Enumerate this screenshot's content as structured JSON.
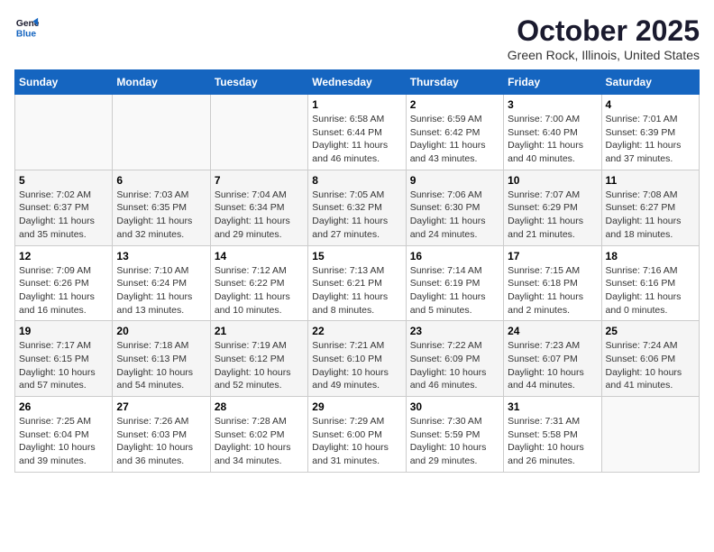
{
  "logo": {
    "line1": "General",
    "line2": "Blue"
  },
  "title": "October 2025",
  "subtitle": "Green Rock, Illinois, United States",
  "weekdays": [
    "Sunday",
    "Monday",
    "Tuesday",
    "Wednesday",
    "Thursday",
    "Friday",
    "Saturday"
  ],
  "weeks": [
    [
      {
        "day": "",
        "content": ""
      },
      {
        "day": "",
        "content": ""
      },
      {
        "day": "",
        "content": ""
      },
      {
        "day": "1",
        "content": "Sunrise: 6:58 AM\nSunset: 6:44 PM\nDaylight: 11 hours and 46 minutes."
      },
      {
        "day": "2",
        "content": "Sunrise: 6:59 AM\nSunset: 6:42 PM\nDaylight: 11 hours and 43 minutes."
      },
      {
        "day": "3",
        "content": "Sunrise: 7:00 AM\nSunset: 6:40 PM\nDaylight: 11 hours and 40 minutes."
      },
      {
        "day": "4",
        "content": "Sunrise: 7:01 AM\nSunset: 6:39 PM\nDaylight: 11 hours and 37 minutes."
      }
    ],
    [
      {
        "day": "5",
        "content": "Sunrise: 7:02 AM\nSunset: 6:37 PM\nDaylight: 11 hours and 35 minutes."
      },
      {
        "day": "6",
        "content": "Sunrise: 7:03 AM\nSunset: 6:35 PM\nDaylight: 11 hours and 32 minutes."
      },
      {
        "day": "7",
        "content": "Sunrise: 7:04 AM\nSunset: 6:34 PM\nDaylight: 11 hours and 29 minutes."
      },
      {
        "day": "8",
        "content": "Sunrise: 7:05 AM\nSunset: 6:32 PM\nDaylight: 11 hours and 27 minutes."
      },
      {
        "day": "9",
        "content": "Sunrise: 7:06 AM\nSunset: 6:30 PM\nDaylight: 11 hours and 24 minutes."
      },
      {
        "day": "10",
        "content": "Sunrise: 7:07 AM\nSunset: 6:29 PM\nDaylight: 11 hours and 21 minutes."
      },
      {
        "day": "11",
        "content": "Sunrise: 7:08 AM\nSunset: 6:27 PM\nDaylight: 11 hours and 18 minutes."
      }
    ],
    [
      {
        "day": "12",
        "content": "Sunrise: 7:09 AM\nSunset: 6:26 PM\nDaylight: 11 hours and 16 minutes."
      },
      {
        "day": "13",
        "content": "Sunrise: 7:10 AM\nSunset: 6:24 PM\nDaylight: 11 hours and 13 minutes."
      },
      {
        "day": "14",
        "content": "Sunrise: 7:12 AM\nSunset: 6:22 PM\nDaylight: 11 hours and 10 minutes."
      },
      {
        "day": "15",
        "content": "Sunrise: 7:13 AM\nSunset: 6:21 PM\nDaylight: 11 hours and 8 minutes."
      },
      {
        "day": "16",
        "content": "Sunrise: 7:14 AM\nSunset: 6:19 PM\nDaylight: 11 hours and 5 minutes."
      },
      {
        "day": "17",
        "content": "Sunrise: 7:15 AM\nSunset: 6:18 PM\nDaylight: 11 hours and 2 minutes."
      },
      {
        "day": "18",
        "content": "Sunrise: 7:16 AM\nSunset: 6:16 PM\nDaylight: 11 hours and 0 minutes."
      }
    ],
    [
      {
        "day": "19",
        "content": "Sunrise: 7:17 AM\nSunset: 6:15 PM\nDaylight: 10 hours and 57 minutes."
      },
      {
        "day": "20",
        "content": "Sunrise: 7:18 AM\nSunset: 6:13 PM\nDaylight: 10 hours and 54 minutes."
      },
      {
        "day": "21",
        "content": "Sunrise: 7:19 AM\nSunset: 6:12 PM\nDaylight: 10 hours and 52 minutes."
      },
      {
        "day": "22",
        "content": "Sunrise: 7:21 AM\nSunset: 6:10 PM\nDaylight: 10 hours and 49 minutes."
      },
      {
        "day": "23",
        "content": "Sunrise: 7:22 AM\nSunset: 6:09 PM\nDaylight: 10 hours and 46 minutes."
      },
      {
        "day": "24",
        "content": "Sunrise: 7:23 AM\nSunset: 6:07 PM\nDaylight: 10 hours and 44 minutes."
      },
      {
        "day": "25",
        "content": "Sunrise: 7:24 AM\nSunset: 6:06 PM\nDaylight: 10 hours and 41 minutes."
      }
    ],
    [
      {
        "day": "26",
        "content": "Sunrise: 7:25 AM\nSunset: 6:04 PM\nDaylight: 10 hours and 39 minutes."
      },
      {
        "day": "27",
        "content": "Sunrise: 7:26 AM\nSunset: 6:03 PM\nDaylight: 10 hours and 36 minutes."
      },
      {
        "day": "28",
        "content": "Sunrise: 7:28 AM\nSunset: 6:02 PM\nDaylight: 10 hours and 34 minutes."
      },
      {
        "day": "29",
        "content": "Sunrise: 7:29 AM\nSunset: 6:00 PM\nDaylight: 10 hours and 31 minutes."
      },
      {
        "day": "30",
        "content": "Sunrise: 7:30 AM\nSunset: 5:59 PM\nDaylight: 10 hours and 29 minutes."
      },
      {
        "day": "31",
        "content": "Sunrise: 7:31 AM\nSunset: 5:58 PM\nDaylight: 10 hours and 26 minutes."
      },
      {
        "day": "",
        "content": ""
      }
    ]
  ]
}
